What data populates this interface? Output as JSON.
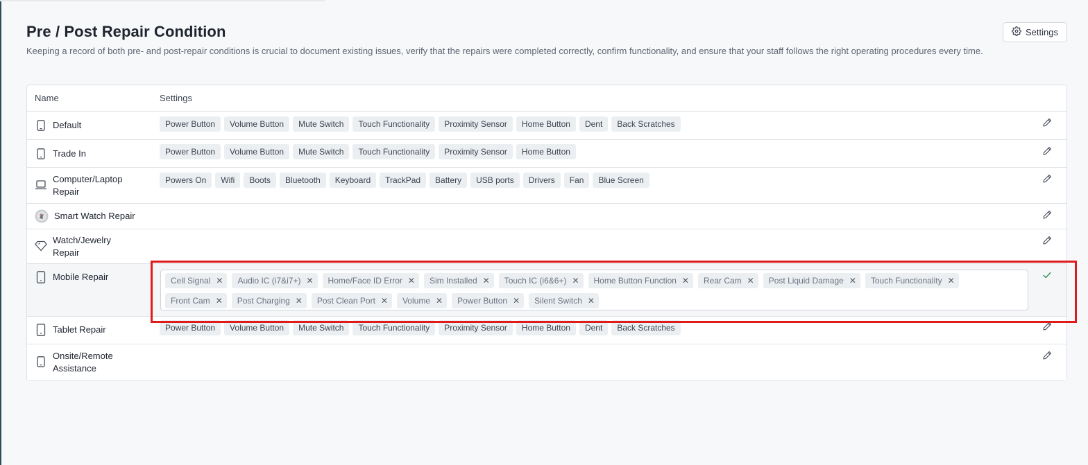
{
  "header": {
    "title": "Pre / Post Repair Condition",
    "description": "Keeping a record of both pre- and post-repair conditions is crucial to document existing issues, verify that the repairs were completed correctly, confirm functionality, and ensure that your staff follows the right operating procedures every time.",
    "settings_label": "Settings"
  },
  "table": {
    "columns": [
      "Name",
      "Settings"
    ],
    "rows": [
      {
        "name": "Default",
        "icon": "phone-icon",
        "chips": [
          "Power Button",
          "Volume Button",
          "Mute Switch",
          "Touch Functionality",
          "Proximity Sensor",
          "Home Button",
          "Dent",
          "Back Scratches"
        ]
      },
      {
        "name": "Trade In",
        "icon": "phone-icon",
        "chips": [
          "Power Button",
          "Volume Button",
          "Mute Switch",
          "Touch Functionality",
          "Proximity Sensor",
          "Home Button"
        ]
      },
      {
        "name": "Computer/Laptop Repair",
        "icon": "laptop-icon",
        "chips": [
          "Powers On",
          "Wifi",
          "Boots",
          "Bluetooth",
          "Keyboard",
          "TrackPad",
          "Battery",
          "USB ports",
          "Drivers",
          "Fan",
          "Blue Screen"
        ]
      },
      {
        "name": "Smart Watch Repair",
        "icon": "avatar-image",
        "chips": []
      },
      {
        "name": "Watch/Jewelry Repair",
        "icon": "diamond-icon",
        "chips": []
      },
      {
        "name": "Mobile Repair",
        "icon": "mobile-icon",
        "editing": true,
        "tags": [
          "Cell Signal",
          "Audio IC (i7&i7+)",
          "Home/Face ID Error",
          "Sim Installed",
          "Touch IC (i6&6+)",
          "Home Button Function",
          "Rear Cam",
          "Post Liquid Damage",
          "Touch Functionality",
          "Front Cam",
          "Post Charging",
          "Post Clean Port",
          "Volume",
          "Power Button",
          "Silent Switch"
        ]
      },
      {
        "name": "Tablet Repair",
        "icon": "tablet-icon",
        "chips": [
          "Power Button",
          "Volume Button",
          "Mute Switch",
          "Touch Functionality",
          "Proximity Sensor",
          "Home Button",
          "Dent",
          "Back Scratches"
        ]
      },
      {
        "name": "Onsite/Remote Assistance",
        "icon": "phone-icon",
        "chips": []
      }
    ]
  },
  "colors": {
    "highlight": "#e01b1b",
    "accent_check": "#2e8b57",
    "chip_bg": "#eceff2"
  }
}
